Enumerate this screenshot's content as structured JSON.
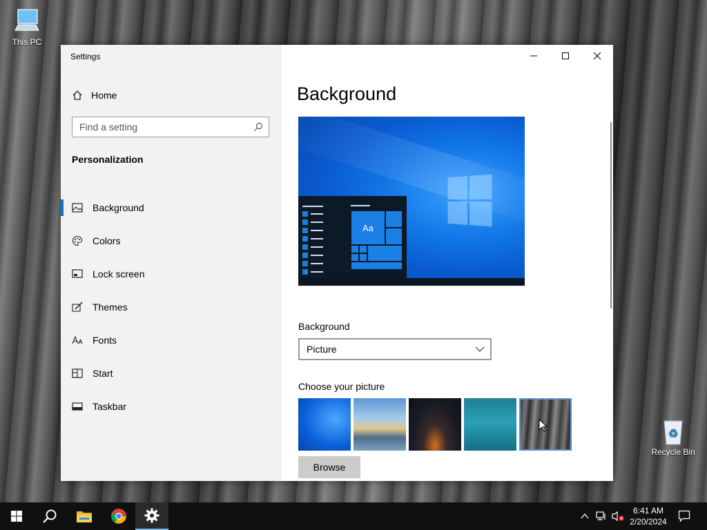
{
  "desktop": {
    "icons": [
      {
        "label": "This PC",
        "icon": "computer-icon"
      },
      {
        "label": "Recycle Bin",
        "icon": "recycle-bin-icon"
      }
    ]
  },
  "window": {
    "title": "Settings",
    "controls": [
      "minimize",
      "maximize",
      "close"
    ]
  },
  "sidebar": {
    "home_label": "Home",
    "search_placeholder": "Find a setting",
    "section_title": "Personalization",
    "items": [
      {
        "label": "Background",
        "icon": "picture-icon",
        "active": true
      },
      {
        "label": "Colors",
        "icon": "palette-icon",
        "active": false
      },
      {
        "label": "Lock screen",
        "icon": "lock-screen-icon",
        "active": false
      },
      {
        "label": "Themes",
        "icon": "brush-icon",
        "active": false
      },
      {
        "label": "Fonts",
        "icon": "font-icon",
        "active": false
      },
      {
        "label": "Start",
        "icon": "start-icon",
        "active": false
      },
      {
        "label": "Taskbar",
        "icon": "taskbar-icon",
        "active": false
      }
    ]
  },
  "main": {
    "heading": "Background",
    "preview_tile_label": "Aa",
    "background_label": "Background",
    "background_value": "Picture",
    "choose_label": "Choose your picture",
    "browse_label": "Browse",
    "selected_picture_index": 4,
    "accent_color": "#0078d7"
  },
  "taskbar": {
    "time": "6:41 AM",
    "date": "2/20/2024",
    "pinned": [
      "start-icon",
      "search-icon",
      "file-explorer-icon",
      "chrome-icon",
      "settings-icon"
    ]
  }
}
